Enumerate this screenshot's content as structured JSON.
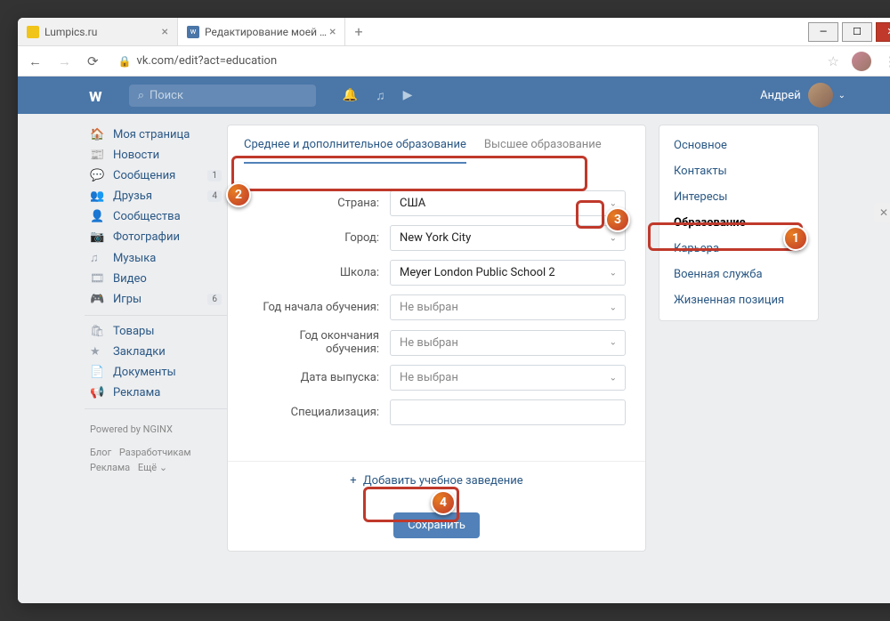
{
  "browser": {
    "tabs": [
      {
        "title": "Lumpics.ru",
        "active": false
      },
      {
        "title": "Редактирование моей страницы",
        "active": true
      }
    ],
    "url": "vk.com/edit?act=education"
  },
  "vk": {
    "search_placeholder": "Поиск",
    "username": "Андрей"
  },
  "sidebar": {
    "items": [
      {
        "icon": "🏠",
        "label": "Моя страница"
      },
      {
        "icon": "📰",
        "label": "Новости"
      },
      {
        "icon": "💬",
        "label": "Сообщения",
        "badge": "1"
      },
      {
        "icon": "👥",
        "label": "Друзья",
        "badge": "4"
      },
      {
        "icon": "👤",
        "label": "Сообщества"
      },
      {
        "icon": "📷",
        "label": "Фотографии"
      },
      {
        "icon": "♫",
        "label": "Музыка"
      },
      {
        "icon": "🎞",
        "label": "Видео"
      },
      {
        "icon": "🎮",
        "label": "Игры",
        "badge": "6"
      }
    ],
    "items2": [
      {
        "icon": "🛍",
        "label": "Товары"
      },
      {
        "icon": "★",
        "label": "Закладки"
      },
      {
        "icon": "📄",
        "label": "Документы"
      },
      {
        "icon": "📢",
        "label": "Реклама"
      }
    ],
    "powered": "Powered by NGINX",
    "footer": {
      "blog": "Блог",
      "dev": "Разработчикам",
      "ads": "Реклама",
      "more": "Ещё ⌄"
    }
  },
  "tabs": {
    "secondary": "Среднее и дополнительное образование",
    "higher": "Высшее образование"
  },
  "form": {
    "country": {
      "label": "Страна:",
      "value": "США"
    },
    "city": {
      "label": "Город:",
      "value": "New York City"
    },
    "school": {
      "label": "Школа:",
      "value": "Meyer London Public School 2"
    },
    "start_year": {
      "label": "Год начала обучения:",
      "value": "Не выбран"
    },
    "end_year": {
      "label": "Год окончания обучения:",
      "value": "Не выбран"
    },
    "grad_date": {
      "label": "Дата выпуска:",
      "value": "Не выбран"
    },
    "spec": {
      "label": "Специализация:",
      "value": ""
    },
    "add_link": "Добавить учебное заведение",
    "save": "Сохранить"
  },
  "settings": {
    "items": [
      "Основное",
      "Контакты",
      "Интересы",
      "Образование",
      "Карьера",
      "Военная служба",
      "Жизненная позиция"
    ],
    "active_index": 3
  }
}
